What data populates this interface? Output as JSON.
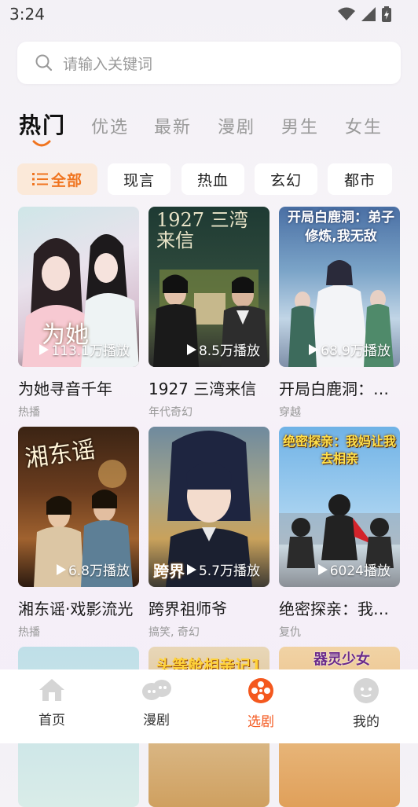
{
  "status_bar": {
    "time": "3:24"
  },
  "search": {
    "placeholder": "请输入关键词"
  },
  "tabs": [
    {
      "label": "热门",
      "active": true
    },
    {
      "label": "优选"
    },
    {
      "label": "最新"
    },
    {
      "label": "漫剧"
    },
    {
      "label": "男生"
    },
    {
      "label": "女生"
    }
  ],
  "chips": [
    {
      "label": "全部",
      "active": true
    },
    {
      "label": "现言"
    },
    {
      "label": "热血"
    },
    {
      "label": "玄幻"
    },
    {
      "label": "都市"
    }
  ],
  "cards": [
    {
      "title": "为她寻音千年",
      "tag": "热播",
      "plays": "113.1万播放",
      "poster_text": "为她"
    },
    {
      "title": "1927 三湾来信",
      "tag": "年代奇幻",
      "plays": "8.5万播放",
      "poster_text": "1927 三湾来信"
    },
    {
      "title": "开局白鹿洞：…",
      "tag": "穿越",
      "plays": "68.9万播放",
      "poster_text": "开局白鹿洞：弟子修炼,我无敌"
    },
    {
      "title": "湘东谣·戏影流光",
      "tag": "热播",
      "plays": "6.8万播放",
      "poster_text": "湘东谣"
    },
    {
      "title": "跨界祖师爷",
      "tag": "搞笑, 奇幻",
      "plays": "5.7万播放",
      "poster_text": "跨界"
    },
    {
      "title": "绝密探亲：我…",
      "tag": "复仇",
      "plays": "6024播放",
      "poster_text": "绝密探亲：我妈让我去相亲"
    },
    {
      "title": "",
      "tag": "",
      "plays": "",
      "poster_text": ""
    },
    {
      "title": "",
      "tag": "",
      "plays": "",
      "poster_text": "头等舱相亲记1"
    },
    {
      "title": "",
      "tag": "",
      "plays": "",
      "poster_text": "器灵少女"
    }
  ],
  "nav": [
    {
      "label": "首页",
      "icon": "home-icon"
    },
    {
      "label": "漫剧",
      "icon": "comic-icon"
    },
    {
      "label": "选剧",
      "icon": "film-reel-icon",
      "active": true
    },
    {
      "label": "我的",
      "icon": "profile-icon"
    }
  ],
  "colors": {
    "accent": "#f0741f",
    "active_nav": "#f4581e"
  }
}
